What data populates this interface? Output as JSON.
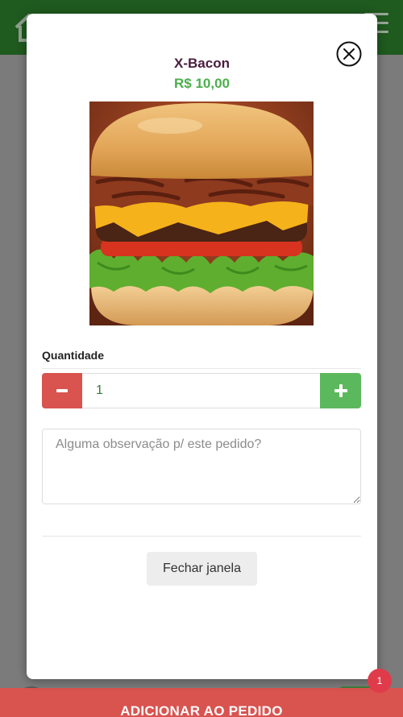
{
  "product": {
    "name": "X-Bacon",
    "price": "R$ 10,00"
  },
  "quantity": {
    "label": "Quantidade",
    "value": "1"
  },
  "notes": {
    "placeholder": "Alguma observação p/ este pedido?"
  },
  "buttons": {
    "close_window": "Fechar janela",
    "add_to_order": "ADICIONAR AO PEDIDO"
  },
  "cart": {
    "count": "1"
  },
  "icons": {
    "home": "home-icon",
    "menu": "menu-icon",
    "close": "close-circle-icon",
    "minus": "minus-icon",
    "plus": "plus-icon"
  },
  "colors": {
    "header": "#1f5a1f",
    "price": "#4cae4c",
    "name": "#4a1d3f",
    "minus_button": "#d9534f",
    "plus_button": "#5cb85c",
    "add_bar": "#d9534f",
    "badge": "#e03b4a"
  }
}
